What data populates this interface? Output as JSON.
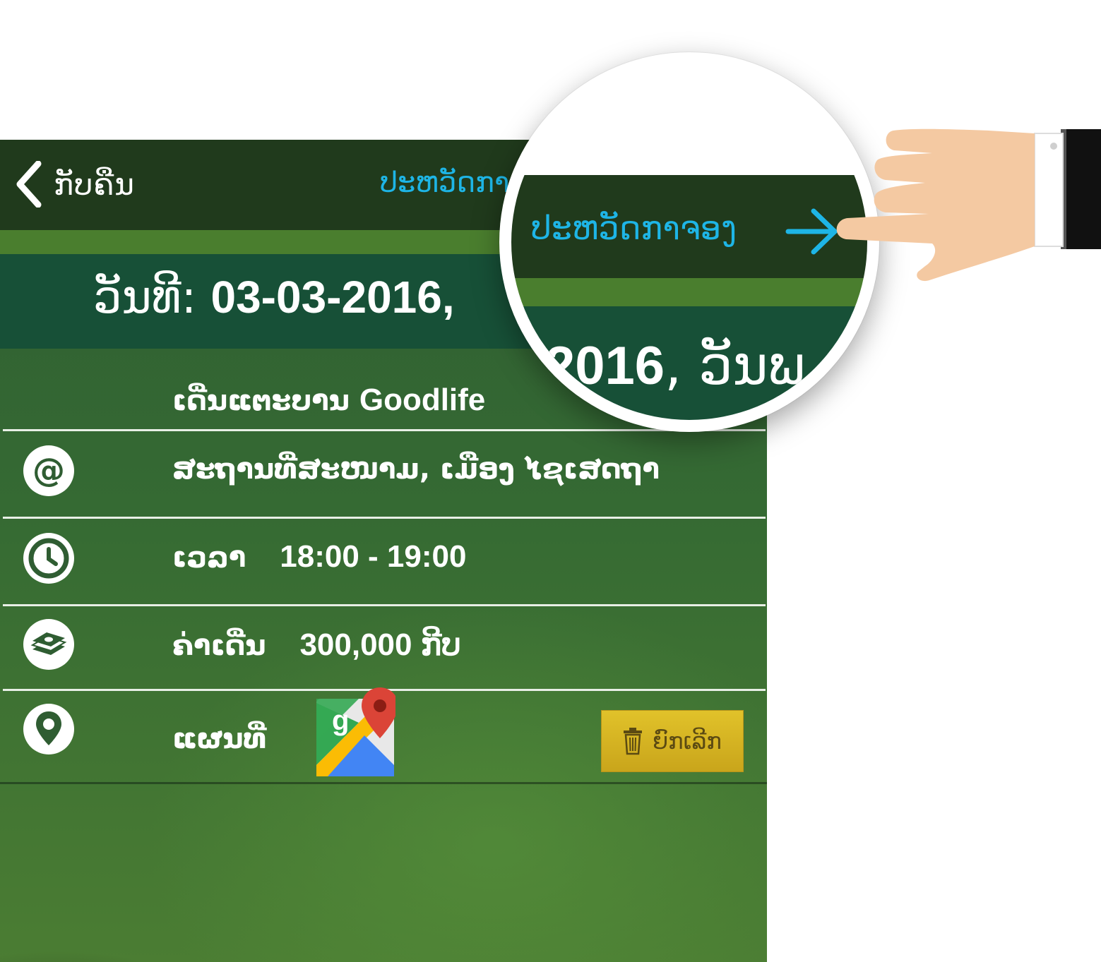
{
  "header": {
    "back_label": "ກັບຄືນ",
    "history_link": "ປະຫວັດກາຈອງ"
  },
  "date": {
    "label": "ວັນທີ:",
    "value": "03-03-2016,"
  },
  "booking": {
    "title_lao": "ເດີ່ນແຕະບານ",
    "title_brand": "Goodlife",
    "location": "ສະຖານທີ່ສະໜາມ, ເມືອງ ໄຊເສດຖາ",
    "time_label": "ເວລາ",
    "time_value": "18:00 - 19:00",
    "price_label": "ຄ່າເດີ່ນ",
    "price_value": "300,000 ກີບ",
    "map_label": "ແຜນທີ່",
    "cancel_label": "ຍົກເລີກ"
  },
  "magnifier": {
    "link_text": "ປະຫວັດກາຈອງ",
    "date_fragment_num": "2016",
    "date_fragment_text": ", ວັນພ"
  },
  "colors": {
    "accent_link": "#1eb5e6",
    "topbar": "#203a1c",
    "date_band": "#175037",
    "cancel_button": "#d6b524"
  },
  "icons": [
    "back-chevron-icon",
    "at-sign-icon",
    "clock-icon",
    "money-stack-icon",
    "location-pin-icon",
    "google-maps-icon",
    "trash-icon",
    "arrow-right-icon",
    "pointing-hand-icon"
  ]
}
